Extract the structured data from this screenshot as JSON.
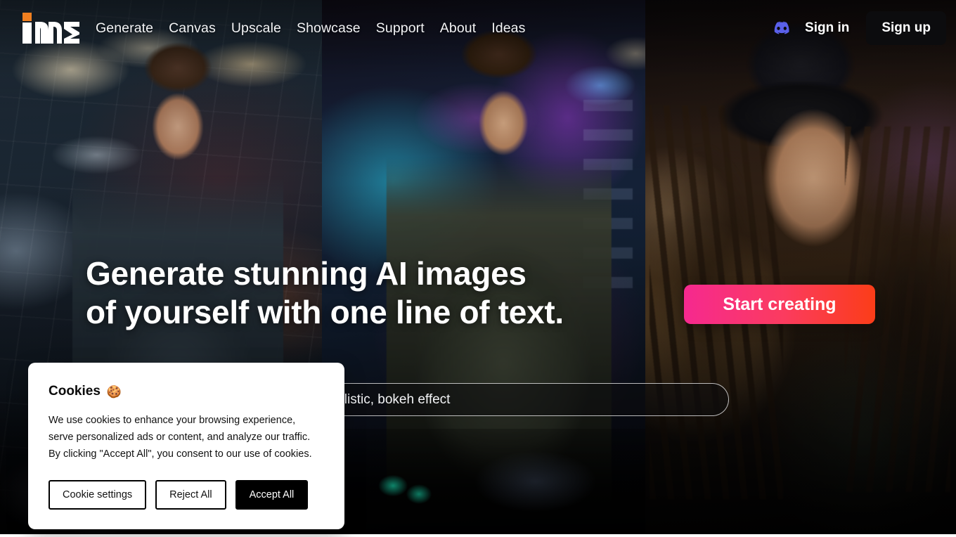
{
  "brand": {
    "name": "ime",
    "logo_icon": "ime-wordmark-logo",
    "accent_color": "#f07f20"
  },
  "header": {
    "nav": [
      {
        "label": "Generate",
        "name": "nav-generate"
      },
      {
        "label": "Canvas",
        "name": "nav-canvas"
      },
      {
        "label": "Upscale",
        "name": "nav-upscale"
      },
      {
        "label": "Showcase",
        "name": "nav-showcase"
      },
      {
        "label": "Support",
        "name": "nav-support"
      },
      {
        "label": "About",
        "name": "nav-about"
      },
      {
        "label": "Ideas",
        "name": "nav-ideas"
      }
    ],
    "discord_icon": "discord-icon",
    "discord_color": "#5a60ea",
    "sign_in_label": "Sign in",
    "sign_up_label": "Sign up"
  },
  "hero": {
    "title": "Generate stunning AI images\nof yourself with one line of text.",
    "cta_label": "Start creating",
    "cta_gradient_from": "#f6298f",
    "cta_gradient_to": "#fb3d18",
    "prompt_value": "a rave, in a warehouse, photorealistic, bokeh effect",
    "prompt_placeholder": "a rave, in a warehouse, photorealistic, bokeh effect"
  },
  "cookie_dialog": {
    "title": "Cookies",
    "emoji": "🍪",
    "emoji_icon": "cookie-icon",
    "body": "We use cookies to enhance your browsing experience, serve personalized ads or content, and analyze our traffic. By clicking \"Accept All\", you consent to our use of cookies.",
    "settings_label": "Cookie settings",
    "reject_label": "Reject All",
    "accept_label": "Accept All"
  }
}
